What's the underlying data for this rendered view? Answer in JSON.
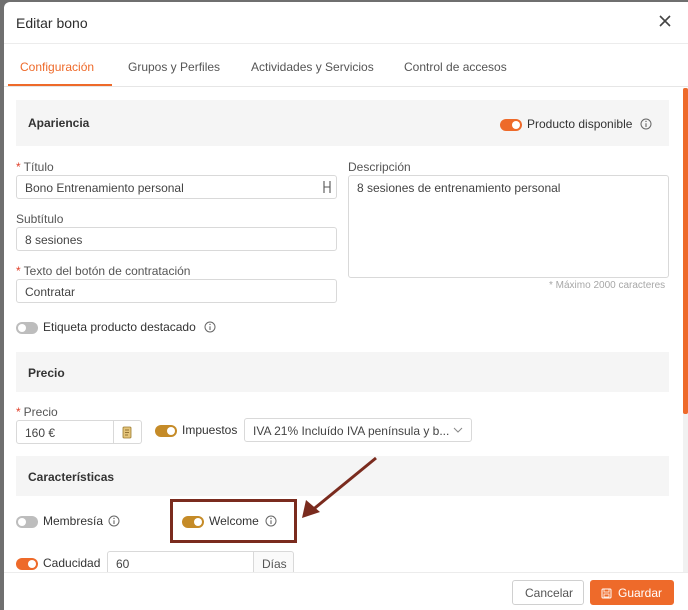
{
  "modal": {
    "title": "Editar bono"
  },
  "tabs": [
    {
      "label": "Configuración"
    },
    {
      "label": "Grupos y Perfiles"
    },
    {
      "label": "Actividades y Servicios"
    },
    {
      "label": "Control de accesos"
    }
  ],
  "apariencia": {
    "title": "Apariencia",
    "producto_disponible": {
      "label": "Producto disponible",
      "on": true
    },
    "titulo": {
      "label": "Título",
      "value": "Bono Entrenamiento personal"
    },
    "subtitulo": {
      "label": "Subtítulo",
      "value": "8 sesiones"
    },
    "texto_boton": {
      "label": "Texto del botón de contratación",
      "value": "Contratar"
    },
    "descripcion": {
      "label": "Descripción",
      "value": "8 sesiones de entrenamiento personal",
      "hint": "* Máximo 2000 caracteres"
    },
    "destacado": {
      "label": "Etiqueta producto destacado",
      "on": false
    }
  },
  "precio": {
    "title": "Precio",
    "precio_label": "Precio",
    "precio_value": "160 €",
    "impuestos": {
      "label": "Impuestos",
      "on": true
    },
    "iva_select": "IVA 21% Incluído IVA península y b..."
  },
  "caracteristicas": {
    "title": "Características",
    "membresia": {
      "label": "Membresía",
      "on": false
    },
    "welcome": {
      "label": "Welcome",
      "on": true
    },
    "caducidad": {
      "label": "Caducidad",
      "on": true,
      "value": "60",
      "unit": "Días"
    }
  },
  "footer": {
    "cancel": "Cancelar",
    "save": "Guardar"
  },
  "colors": {
    "accent": "#ee6a2a",
    "toggle_gold": "#c58b28",
    "annotation": "#7a2b1e"
  }
}
